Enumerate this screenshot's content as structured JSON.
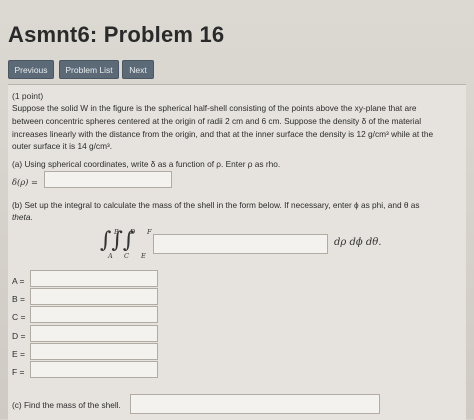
{
  "header": {
    "title": "Asmnt6: Problem 16"
  },
  "nav": {
    "previous": "Previous",
    "problem_list": "Problem List",
    "next": "Next"
  },
  "problem": {
    "points": "(1 point)",
    "line1": "Suppose the solid W in the figure is the spherical half-shell consisting of the points above the xy-plane that are",
    "line2": "between concentric spheres centered at the origin of radii 2 cm and 6 cm. Suppose the density δ of the material",
    "line3": "increases linearly with the distance from the origin, and that at the inner surface the density is 12 g/cm³ while at the",
    "line4": "outer surface it is 14 g/cm³."
  },
  "part_a": {
    "prompt": "(a) Using spherical coordinates, write δ as a function of ρ. Enter ρ as rho.",
    "label": "δ(ρ) =",
    "value": ""
  },
  "part_b": {
    "prompt": "(b) Set up the integral to calculate the mass of the shell in the form below. If necessary, enter ϕ as phi, and θ as",
    "prompt2": "theta.",
    "integral_symbol": "∫∫∫",
    "limits": {
      "a": "A",
      "b": "B",
      "c": "C",
      "d": "D",
      "e": "E",
      "f": "F"
    },
    "differentials": "dρ dϕ dθ.",
    "integrand_value": "",
    "fields": [
      {
        "label": "A =",
        "value": ""
      },
      {
        "label": "B =",
        "value": ""
      },
      {
        "label": "C =",
        "value": ""
      },
      {
        "label": "D =",
        "value": ""
      },
      {
        "label": "E =",
        "value": ""
      },
      {
        "label": "F =",
        "value": ""
      }
    ]
  },
  "part_c": {
    "prompt": "(c) Find the mass of the shell.",
    "value": ""
  }
}
